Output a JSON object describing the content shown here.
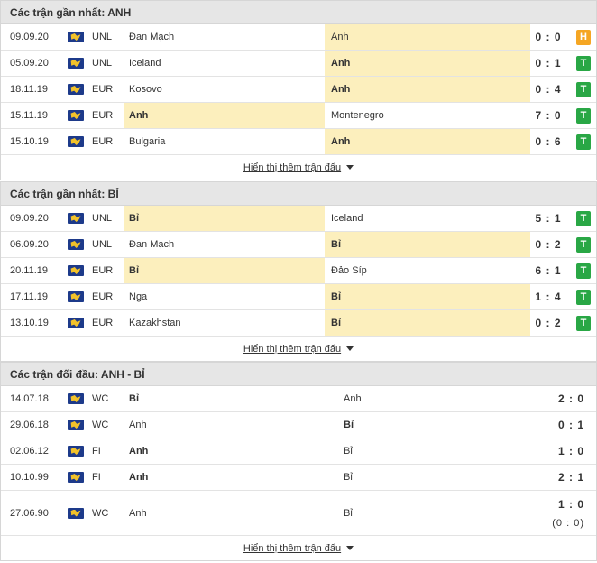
{
  "sections": [
    {
      "title": "Các trận gần nhất: ANH",
      "more_label": "Hiển thị thêm trận đấu",
      "rows": [
        {
          "date": "09.09.20",
          "comp": "UNL",
          "home": "Đan Mạch",
          "away": "Anh",
          "score": "0 : 0",
          "badge": "H",
          "hl": "away",
          "win": "none"
        },
        {
          "date": "05.09.20",
          "comp": "UNL",
          "home": "Iceland",
          "away": "Anh",
          "score": "0 : 1",
          "badge": "T",
          "hl": "away",
          "win": "away"
        },
        {
          "date": "18.11.19",
          "comp": "EUR",
          "home": "Kosovo",
          "away": "Anh",
          "score": "0 : 4",
          "badge": "T",
          "hl": "away",
          "win": "away"
        },
        {
          "date": "15.11.19",
          "comp": "EUR",
          "home": "Anh",
          "away": "Montenegro",
          "score": "7 : 0",
          "badge": "T",
          "hl": "home",
          "win": "home"
        },
        {
          "date": "15.10.19",
          "comp": "EUR",
          "home": "Bulgaria",
          "away": "Anh",
          "score": "0 : 6",
          "badge": "T",
          "hl": "away",
          "win": "away"
        }
      ]
    },
    {
      "title": "Các trận gần nhất: BỈ",
      "more_label": "Hiển thị thêm trận đấu",
      "rows": [
        {
          "date": "09.09.20",
          "comp": "UNL",
          "home": "Bỉ",
          "away": "Iceland",
          "score": "5 : 1",
          "badge": "T",
          "hl": "home",
          "win": "home"
        },
        {
          "date": "06.09.20",
          "comp": "UNL",
          "home": "Đan Mạch",
          "away": "Bỉ",
          "score": "0 : 2",
          "badge": "T",
          "hl": "away",
          "win": "away"
        },
        {
          "date": "20.11.19",
          "comp": "EUR",
          "home": "Bỉ",
          "away": "Đảo Síp",
          "score": "6 : 1",
          "badge": "T",
          "hl": "home",
          "win": "home"
        },
        {
          "date": "17.11.19",
          "comp": "EUR",
          "home": "Nga",
          "away": "Bỉ",
          "score": "1 : 4",
          "badge": "T",
          "hl": "away",
          "win": "away"
        },
        {
          "date": "13.10.19",
          "comp": "EUR",
          "home": "Kazakhstan",
          "away": "Bỉ",
          "score": "0 : 2",
          "badge": "T",
          "hl": "away",
          "win": "away"
        }
      ]
    },
    {
      "title": "Các trận đối đầu: ANH - BỈ",
      "more_label": "Hiển thị thêm trận đấu",
      "rows": [
        {
          "date": "14.07.18",
          "comp": "WC",
          "home": "Bỉ",
          "away": "Anh",
          "score": "2 : 0",
          "win": "home"
        },
        {
          "date": "29.06.18",
          "comp": "WC",
          "home": "Anh",
          "away": "Bỉ",
          "score": "0 : 1",
          "win": "away"
        },
        {
          "date": "02.06.12",
          "comp": "FI",
          "home": "Anh",
          "away": "Bỉ",
          "score": "1 : 0",
          "win": "home"
        },
        {
          "date": "10.10.99",
          "comp": "FI",
          "home": "Anh",
          "away": "Bỉ",
          "score": "2 : 1",
          "win": "home"
        },
        {
          "date": "27.06.90",
          "comp": "WC",
          "home": "Anh",
          "away": "Bỉ",
          "score": "1 : 0",
          "ht_score": "(0 : 0)",
          "win": "none"
        }
      ]
    }
  ],
  "colors": {
    "highlight": "#fcefbd",
    "win_badge": "#29a745",
    "draw_badge": "#f5a623",
    "flag": "#1d3a8a"
  },
  "icons": {
    "flag": "world-flag-icon",
    "more": "caret-down-icon"
  }
}
